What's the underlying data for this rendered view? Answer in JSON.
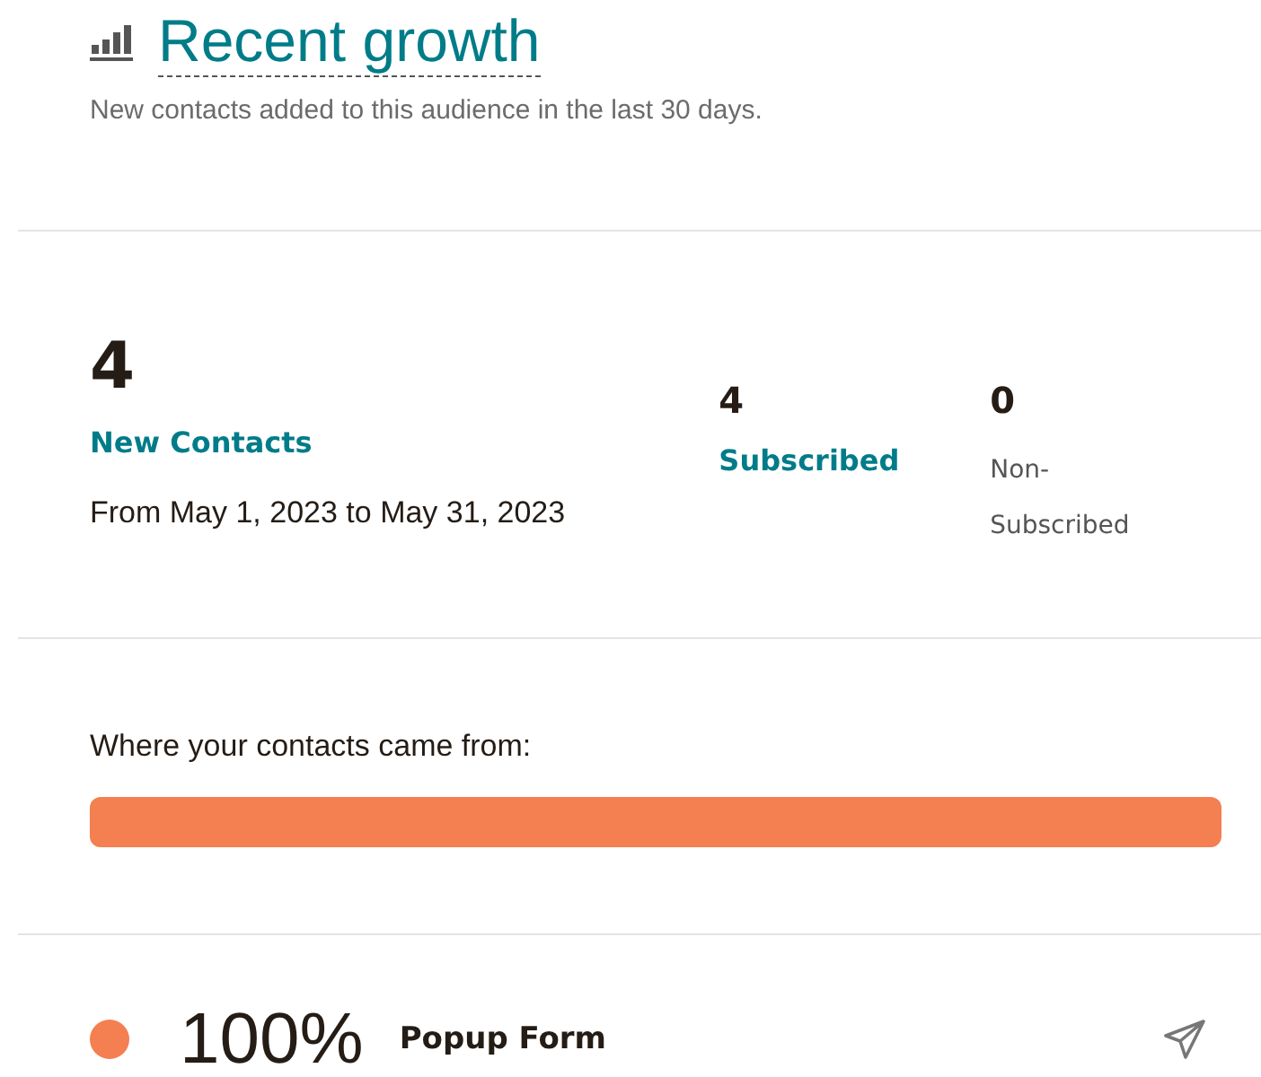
{
  "header": {
    "title": "Recent growth",
    "subtitle": "New contacts added to this audience in the last 30 days."
  },
  "summary": {
    "total": "4",
    "total_label": "New Contacts",
    "range": "From May 1, 2023 to May 31, 2023",
    "stats": [
      {
        "value": "4",
        "label": "Subscribed",
        "kind": "link"
      },
      {
        "value": "0",
        "label": "Non-Subscribed",
        "kind": "plain"
      }
    ]
  },
  "sources": {
    "heading": "Where your contacts came from:",
    "items": [
      {
        "percent": "100%",
        "name": "Popup Form",
        "color": "#f47f51"
      }
    ]
  }
}
